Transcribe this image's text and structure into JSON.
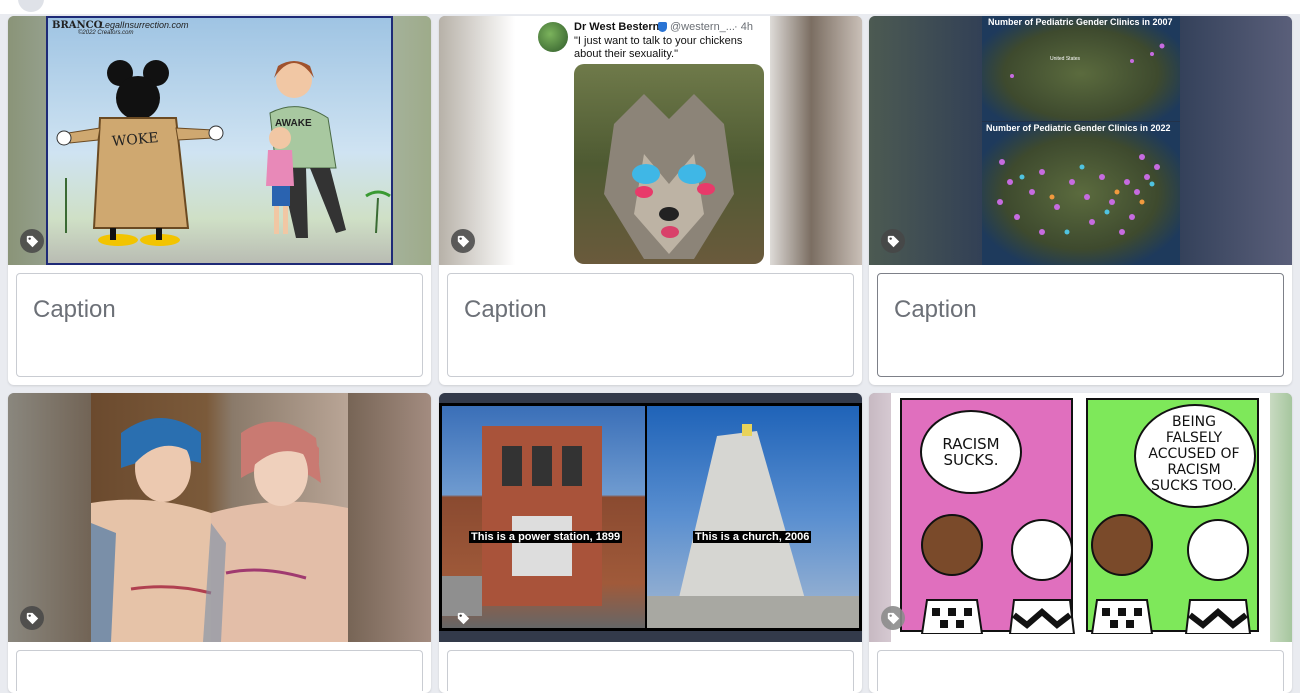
{
  "caption_placeholder": "Caption",
  "cards": {
    "c1": {
      "signature": "BRANCO",
      "site": "LegalInsurrection.com",
      "copyright": "©2022 Creators.com",
      "coat_label": "WOKE",
      "shirt_label": "AWAKE"
    },
    "c2": {
      "user_name": "Dr West Bestern",
      "user_handle": "@western_...",
      "time": "· 4h",
      "tweet_text": "\"I just want to talk to your chickens about their sexuality.\""
    },
    "c3": {
      "map_title_top": "Number of Pediatric Gender Clinics in 2007",
      "map_title_bottom": "Number of Pediatric Gender Clinics in 2022",
      "map_label": "United States"
    },
    "c5": {
      "left_label": "This is a power station, 1899",
      "right_label": "This is a church, 2006"
    },
    "c6": {
      "left_bubble": "RACISM SUCKS.",
      "right_bubble": "BEING FALSELY ACCUSED OF RACISM SUCKS TOO."
    }
  },
  "colors": {
    "tag": "#464646",
    "pink_panel": "#e06fbe",
    "green_panel": "#7ee85a"
  },
  "icons": [
    "tag-icon",
    "verified-badge-icon"
  ]
}
